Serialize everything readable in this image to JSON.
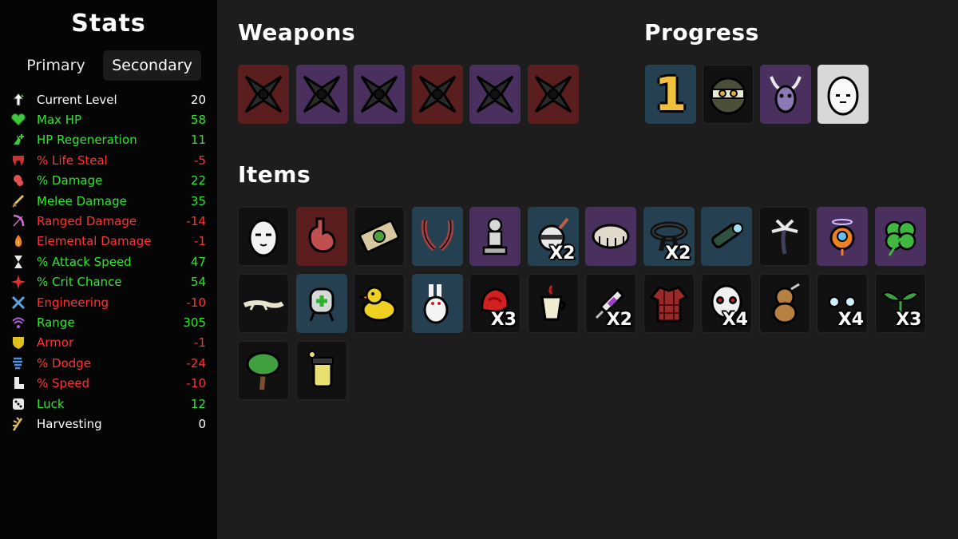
{
  "sidebar": {
    "title": "Stats",
    "tabs": [
      "Primary",
      "Secondary"
    ],
    "active_tab": "Secondary",
    "stats": [
      {
        "label": "Current Level",
        "value": "20",
        "color": "#ffffff",
        "icon": "level-up-icon"
      },
      {
        "label": "Max HP",
        "value": "58",
        "color": "#2ee62e",
        "icon": "heart-icon"
      },
      {
        "label": "HP Regeneration",
        "value": "11",
        "color": "#2ee62e",
        "icon": "regen-icon"
      },
      {
        "label": "% Life Steal",
        "value": "-5",
        "color": "#ff3333",
        "icon": "fang-icon"
      },
      {
        "label": "% Damage",
        "value": "22",
        "color": "#2ee62e",
        "icon": "muscle-icon"
      },
      {
        "label": "Melee Damage",
        "value": "35",
        "color": "#2ee62e",
        "icon": "sword-icon"
      },
      {
        "label": "Ranged Damage",
        "value": "-14",
        "color": "#ff3333",
        "icon": "bow-icon"
      },
      {
        "label": "Elemental Damage",
        "value": "-1",
        "color": "#ff3333",
        "icon": "flame-icon"
      },
      {
        "label": "% Attack Speed",
        "value": "47",
        "color": "#2ee62e",
        "icon": "hourglass-icon"
      },
      {
        "label": "% Crit Chance",
        "value": "54",
        "color": "#2ee62e",
        "icon": "crit-icon"
      },
      {
        "label": "Engineering",
        "value": "-10",
        "color": "#ff3333",
        "icon": "wrench-icon"
      },
      {
        "label": "Range",
        "value": "305",
        "color": "#2ee62e",
        "icon": "range-icon"
      },
      {
        "label": "Armor",
        "value": "-1",
        "color": "#ff3333",
        "icon": "shield-icon"
      },
      {
        "label": "% Dodge",
        "value": "-24",
        "color": "#ff3333",
        "icon": "dodge-icon"
      },
      {
        "label": "% Speed",
        "value": "-10",
        "color": "#ff3333",
        "icon": "boot-icon"
      },
      {
        "label": "Luck",
        "value": "12",
        "color": "#2ee62e",
        "icon": "dice-icon"
      },
      {
        "label": "Harvesting",
        "value": "0",
        "color": "#ffffff",
        "icon": "harvest-icon"
      }
    ]
  },
  "weapons": {
    "title": "Weapons",
    "items": [
      {
        "icon": "shuriken-icon",
        "tier": "red"
      },
      {
        "icon": "shuriken-icon",
        "tier": "purple"
      },
      {
        "icon": "shuriken-icon",
        "tier": "purple"
      },
      {
        "icon": "shuriken-icon",
        "tier": "red"
      },
      {
        "icon": "shuriken-icon",
        "tier": "purple"
      },
      {
        "icon": "shuriken-icon",
        "tier": "red"
      }
    ]
  },
  "progress": {
    "title": "Progress",
    "level_number": "1",
    "items": [
      {
        "icon": "ninja-face-icon",
        "tier": "black"
      },
      {
        "icon": "horned-skull-icon",
        "tier": "purple"
      },
      {
        "icon": "egg-character-icon",
        "tier": "white"
      }
    ]
  },
  "items": {
    "title": "Items",
    "list": [
      {
        "icon": "egg-face-icon",
        "tier": "black",
        "qty": ""
      },
      {
        "icon": "stomach-icon",
        "tier": "red",
        "qty": ""
      },
      {
        "icon": "money-bill-icon",
        "tier": "black",
        "qty": ""
      },
      {
        "icon": "claws-icon",
        "tier": "blue",
        "qty": ""
      },
      {
        "icon": "statue-icon",
        "tier": "purple",
        "qty": ""
      },
      {
        "icon": "bomb-robot-icon",
        "tier": "blue",
        "qty": "X2"
      },
      {
        "icon": "tardigrade-icon",
        "tier": "purple",
        "qty": ""
      },
      {
        "icon": "black-belt-icon",
        "tier": "blue",
        "qty": "X2"
      },
      {
        "icon": "scope-icon",
        "tier": "blue",
        "qty": ""
      },
      {
        "icon": "palm-tree-icon",
        "tier": "black",
        "qty": ""
      },
      {
        "icon": "angel-drone-icon",
        "tier": "purple",
        "qty": ""
      },
      {
        "icon": "clover-icon",
        "tier": "purple",
        "qty": ""
      },
      {
        "icon": "lizard-icon",
        "tier": "black",
        "qty": ""
      },
      {
        "icon": "medkit-robot-icon",
        "tier": "blue",
        "qty": ""
      },
      {
        "icon": "duck-icon",
        "tier": "black",
        "qty": ""
      },
      {
        "icon": "rabbit-icon",
        "tier": "blue",
        "qty": ""
      },
      {
        "icon": "red-helmet-icon",
        "tier": "black",
        "qty": "X3"
      },
      {
        "icon": "coffee-icon",
        "tier": "black",
        "qty": ""
      },
      {
        "icon": "syringe-icon",
        "tier": "black",
        "qty": "X2"
      },
      {
        "icon": "plaid-shirt-icon",
        "tier": "black",
        "qty": ""
      },
      {
        "icon": "skull-mask-icon",
        "tier": "black",
        "qty": "X4"
      },
      {
        "icon": "teddy-bear-icon",
        "tier": "black",
        "qty": ""
      },
      {
        "icon": "eyes-icon",
        "tier": "black",
        "qty": "X4"
      },
      {
        "icon": "sprout-icon",
        "tier": "black",
        "qty": "X3"
      },
      {
        "icon": "tree-icon",
        "tier": "black",
        "qty": ""
      },
      {
        "icon": "potion-jar-icon",
        "tier": "black",
        "qty": ""
      }
    ]
  },
  "colors": {
    "positive": "#2ee62e",
    "negative": "#ff3333",
    "neutral": "#ffffff",
    "tier_black": "#111111",
    "tier_red": "#5a1e1e",
    "tier_blue": "#254050",
    "tier_purple": "#49305e",
    "tier_white": "#d8d8d8"
  }
}
